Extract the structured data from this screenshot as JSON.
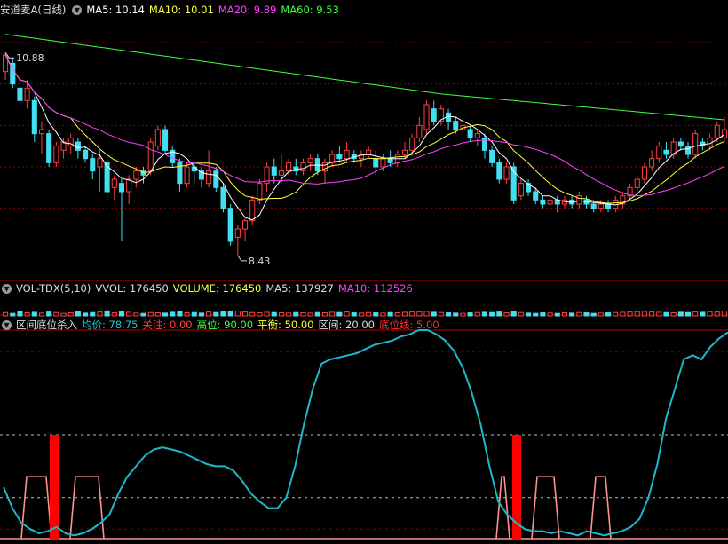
{
  "colors": {
    "background": "#000000",
    "up": "#ff4040",
    "down": "#40e0f0",
    "ma5": "#ffffff",
    "ma10": "#ffff40",
    "ma20": "#ff40ff",
    "ma60": "#40ff40",
    "separator": "#b80000",
    "grid": "#8a0000",
    "signal": "#ff0000",
    "zone": "#ff9090",
    "indicator": "#20b8c8"
  },
  "panels": {
    "price": {
      "title": "安道麦A(日线)",
      "legend": [
        {
          "text": "MA5: 10.14",
          "color": "#ffffff"
        },
        {
          "text": "MA10: 10.01",
          "color": "#ffff40"
        },
        {
          "text": "MA20: 9.89",
          "color": "#ff40ff"
        },
        {
          "text": "MA60: 9.53",
          "color": "#40ff40"
        }
      ],
      "high_label": "10.88",
      "low_label": "8.43"
    },
    "volume": {
      "title": "VOL-TDX(5,10)",
      "legend": [
        {
          "text": "VVOL: 176450",
          "color": "#dcdcdc"
        },
        {
          "text": "VOLUME: 176450",
          "color": "#ffff40"
        },
        {
          "text": "MA5: 137927",
          "color": "#dcdcdc"
        },
        {
          "text": "MA10: 112526",
          "color": "#ff40ff"
        }
      ]
    },
    "indicator": {
      "title": "区间底位杀入",
      "legend": [
        {
          "text": "均价: 78.75",
          "color": "#20c8c8"
        },
        {
          "text": "关注: 0.00",
          "color": "#ff4040"
        },
        {
          "text": "高位: 90.00",
          "color": "#40ff40"
        },
        {
          "text": "平衡: 50.00",
          "color": "#ffff40"
        },
        {
          "text": "区间: 20.00",
          "color": "#dcdcdc"
        },
        {
          "text": "底位线: 5.00",
          "color": "#ff3030"
        }
      ]
    }
  },
  "chart_data": {
    "type": "candlestick",
    "title": "安道麦A(日线)",
    "price_range": [
      8.3,
      11.3
    ],
    "candles": [
      [
        10.65,
        10.85,
        10.55,
        10.88
      ],
      [
        10.75,
        10.5,
        10.45,
        10.82
      ],
      [
        10.45,
        10.3,
        10.25,
        10.6
      ],
      [
        10.3,
        10.45,
        10.2,
        10.55
      ],
      [
        10.3,
        9.9,
        9.8,
        10.35
      ],
      [
        9.9,
        9.95,
        9.65,
        10.05
      ],
      [
        9.9,
        9.55,
        9.5,
        9.95
      ],
      [
        9.55,
        9.75,
        9.5,
        9.8
      ],
      [
        9.7,
        9.8,
        9.6,
        9.85
      ],
      [
        9.75,
        9.85,
        9.65,
        9.9
      ],
      [
        9.8,
        9.7,
        9.6,
        9.85
      ],
      [
        9.7,
        9.6,
        9.55,
        9.75
      ],
      [
        9.6,
        9.45,
        9.35,
        9.65
      ],
      [
        9.5,
        9.6,
        9.2,
        9.7
      ],
      [
        9.55,
        9.2,
        9.1,
        9.6
      ],
      [
        9.25,
        9.35,
        9.1,
        9.4
      ],
      [
        9.3,
        9.2,
        8.6,
        9.35
      ],
      [
        9.2,
        9.35,
        9.05,
        9.4
      ],
      [
        9.35,
        9.45,
        9.25,
        9.5
      ],
      [
        9.45,
        9.4,
        9.3,
        9.5
      ],
      [
        9.45,
        9.8,
        9.4,
        9.85
      ],
      [
        9.75,
        9.95,
        9.7,
        10.0
      ],
      [
        9.95,
        9.7,
        9.65,
        10.0
      ],
      [
        9.7,
        9.55,
        9.5,
        9.75
      ],
      [
        9.55,
        9.3,
        9.2,
        9.6
      ],
      [
        9.3,
        9.5,
        9.25,
        9.55
      ],
      [
        9.5,
        9.45,
        9.3,
        9.55
      ],
      [
        9.45,
        9.35,
        9.25,
        9.5
      ],
      [
        9.3,
        9.45,
        9.25,
        9.7
      ],
      [
        9.45,
        9.25,
        9.2,
        9.5
      ],
      [
        9.25,
        9.0,
        8.95,
        9.3
      ],
      [
        9.0,
        8.6,
        8.55,
        9.05
      ],
      [
        8.65,
        8.75,
        8.43,
        8.8
      ],
      [
        8.75,
        8.85,
        8.6,
        8.9
      ],
      [
        8.85,
        9.1,
        8.8,
        9.15
      ],
      [
        9.1,
        9.3,
        9.05,
        9.35
      ],
      [
        9.3,
        9.5,
        9.2,
        9.55
      ],
      [
        9.5,
        9.4,
        9.3,
        9.6
      ],
      [
        9.4,
        9.45,
        9.3,
        9.65
      ],
      [
        9.45,
        9.55,
        9.4,
        9.6
      ],
      [
        9.5,
        9.45,
        9.4,
        9.6
      ],
      [
        9.45,
        9.55,
        9.4,
        9.6
      ],
      [
        9.55,
        9.6,
        9.45,
        9.65
      ],
      [
        9.6,
        9.45,
        9.4,
        9.65
      ],
      [
        9.45,
        9.55,
        9.3,
        9.6
      ],
      [
        9.55,
        9.65,
        9.5,
        9.7
      ],
      [
        9.65,
        9.6,
        9.55,
        9.75
      ],
      [
        9.6,
        9.7,
        9.55,
        9.8
      ],
      [
        9.65,
        9.6,
        9.55,
        9.7
      ],
      [
        9.6,
        9.65,
        9.5,
        9.7
      ],
      [
        9.65,
        9.7,
        9.6,
        9.75
      ],
      [
        9.6,
        9.5,
        9.4,
        9.7
      ],
      [
        9.5,
        9.6,
        9.45,
        9.65
      ],
      [
        9.6,
        9.55,
        9.5,
        9.7
      ],
      [
        9.55,
        9.65,
        9.5,
        9.7
      ],
      [
        9.65,
        9.7,
        9.6,
        9.8
      ],
      [
        9.7,
        9.85,
        9.65,
        9.9
      ],
      [
        9.85,
        10.0,
        9.8,
        10.1
      ],
      [
        9.95,
        10.25,
        9.9,
        10.3
      ],
      [
        10.2,
        10.05,
        10.0,
        10.3
      ],
      [
        10.05,
        10.2,
        10.0,
        10.25
      ],
      [
        10.15,
        10.05,
        9.95,
        10.2
      ],
      [
        10.05,
        9.95,
        9.9,
        10.1
      ],
      [
        9.95,
        10.0,
        9.9,
        10.05
      ],
      [
        9.95,
        9.85,
        9.8,
        10.0
      ],
      [
        9.85,
        9.9,
        9.75,
        9.95
      ],
      [
        9.85,
        9.7,
        9.6,
        9.9
      ],
      [
        9.7,
        9.55,
        9.5,
        9.75
      ],
      [
        9.55,
        9.35,
        9.3,
        9.6
      ],
      [
        9.35,
        9.5,
        9.3,
        9.55
      ],
      [
        9.5,
        9.1,
        9.05,
        9.55
      ],
      [
        9.15,
        9.3,
        9.1,
        9.35
      ],
      [
        9.3,
        9.2,
        9.15,
        9.35
      ],
      [
        9.2,
        9.1,
        9.05,
        9.25
      ],
      [
        9.1,
        9.05,
        9.0,
        9.15
      ],
      [
        9.05,
        9.1,
        9.0,
        9.15
      ],
      [
        9.1,
        9.05,
        8.95,
        9.15
      ],
      [
        9.05,
        9.1,
        9.0,
        9.15
      ],
      [
        9.1,
        9.05,
        9.0,
        9.15
      ],
      [
        9.05,
        9.15,
        9.0,
        9.2
      ],
      [
        9.1,
        9.05,
        9.0,
        9.15
      ],
      [
        9.05,
        9.0,
        8.95,
        9.1
      ],
      [
        9.0,
        9.05,
        8.95,
        9.1
      ],
      [
        9.05,
        9.0,
        8.95,
        9.1
      ],
      [
        9.0,
        9.1,
        8.95,
        9.15
      ],
      [
        9.05,
        9.15,
        9.0,
        9.2
      ],
      [
        9.15,
        9.25,
        9.1,
        9.3
      ],
      [
        9.25,
        9.35,
        9.2,
        9.4
      ],
      [
        9.35,
        9.5,
        9.3,
        9.55
      ],
      [
        9.5,
        9.6,
        9.45,
        9.7
      ],
      [
        9.6,
        9.75,
        9.55,
        9.8
      ],
      [
        9.7,
        9.65,
        9.6,
        9.8
      ],
      [
        9.65,
        9.8,
        9.6,
        9.85
      ],
      [
        9.8,
        9.75,
        9.7,
        9.85
      ],
      [
        9.75,
        9.65,
        9.6,
        9.8
      ],
      [
        9.65,
        9.9,
        9.6,
        9.95
      ],
      [
        9.8,
        9.75,
        9.7,
        9.85
      ],
      [
        9.75,
        9.85,
        9.7,
        9.9
      ],
      [
        9.85,
        10.0,
        9.8,
        10.05
      ],
      [
        9.85,
        9.95,
        9.8,
        10.1
      ]
    ],
    "volume_range": [
      0,
      700000
    ],
    "volume": [
      120000,
      90000,
      150000,
      110000,
      130000,
      100000,
      140000,
      120000,
      90000,
      110000,
      150000,
      100000,
      120000,
      140000,
      180000,
      110000,
      170000,
      130000,
      100000,
      90000,
      120000,
      110000,
      100000,
      130000,
      160000,
      110000,
      120000,
      100000,
      140000,
      120000,
      160000,
      150000,
      170000,
      140000,
      120000,
      110000,
      130000,
      120000,
      110000,
      100000,
      120000,
      110000,
      100000,
      120000,
      110000,
      130000,
      120000,
      140000,
      110000,
      100000,
      120000,
      110000,
      100000,
      120000,
      110000,
      130000,
      140000,
      150000,
      160000,
      130000,
      120000,
      110000,
      100000,
      90000,
      110000,
      120000,
      130000,
      120000,
      140000,
      110000,
      150000,
      120000,
      100000,
      90000,
      110000,
      100000,
      90000,
      110000,
      100000,
      120000,
      110000,
      90000,
      100000,
      110000,
      120000,
      130000,
      140000,
      150000,
      160000,
      140000,
      130000,
      120000,
      110000,
      130000,
      120000,
      140000,
      130000,
      150000,
      140000,
      176450
    ],
    "indicator_range": [
      0,
      100
    ],
    "indicator_levels": [
      90,
      50,
      20,
      5
    ],
    "indicator": [
      25,
      15,
      8,
      5,
      3,
      4,
      6,
      3,
      2,
      3,
      5,
      8,
      12,
      22,
      30,
      35,
      40,
      43,
      44,
      43,
      42,
      40,
      38,
      36,
      35,
      35,
      33,
      28,
      22,
      18,
      15,
      15,
      20,
      35,
      55,
      72,
      84,
      86,
      87,
      88,
      89,
      91,
      93,
      94,
      95,
      97,
      98,
      100,
      100,
      98,
      95,
      90,
      82,
      70,
      55,
      35,
      18,
      12,
      8,
      5,
      4,
      4,
      3,
      4,
      3,
      2,
      4,
      3,
      2,
      3,
      4,
      6,
      10,
      20,
      36,
      58,
      72,
      86,
      88,
      86,
      92,
      96,
      99
    ],
    "zones": [
      [
        24,
        58
      ],
      [
        79,
        117
      ],
      [
        559,
        574
      ],
      [
        599,
        630
      ],
      [
        665,
        688
      ]
    ],
    "signals": [
      61,
      582
    ]
  }
}
